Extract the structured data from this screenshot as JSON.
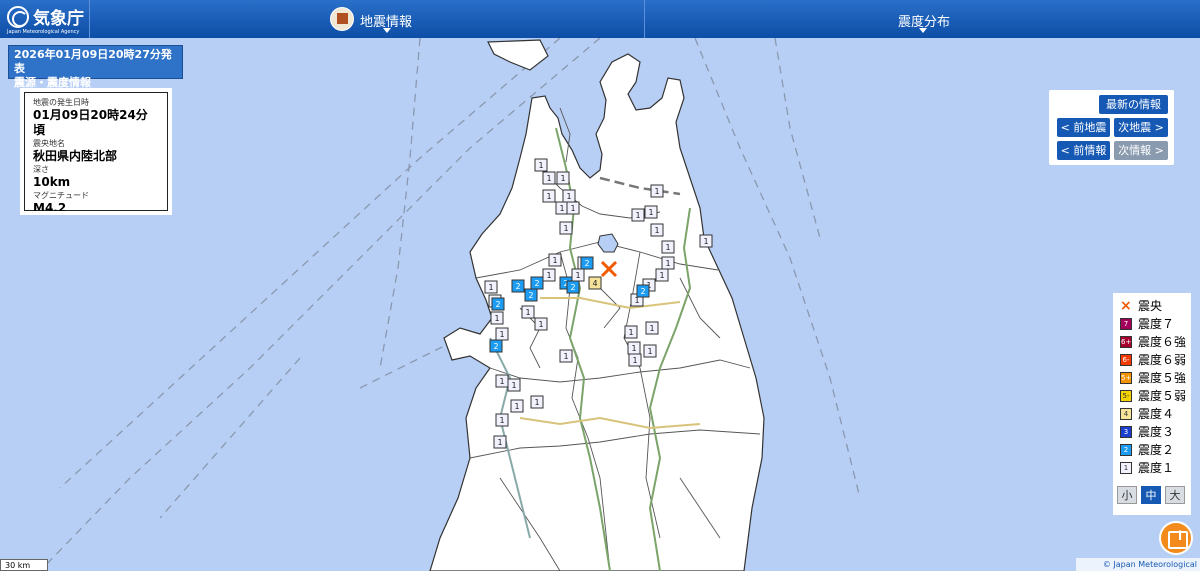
{
  "header": {
    "logo_text": "気象庁",
    "logo_sub": "Japan Meteorological Agency",
    "menu1_label": "地震情報",
    "menu2_label": "震度分布"
  },
  "report": {
    "line1": "2026年01月09日20時27分発表",
    "line2": "震源・震度情報"
  },
  "info": {
    "time_label": "地震の発生日時",
    "time_value": "01月09日20時24分頃",
    "place_label": "震央地名",
    "place_value": "秋田県内陸北部",
    "depth_label": "深さ",
    "depth_value": "10km",
    "mag_label": "マグニチュード",
    "mag_value": "M4.2"
  },
  "nav": {
    "latest": "最新の情報",
    "prev_eq": "< 前地震",
    "next_eq": "次地震 >",
    "prev_info": "< 前情報",
    "next_info": "次情報 >"
  },
  "legend": {
    "items": [
      {
        "label": "震央",
        "mark": "×",
        "color": "#f25a00"
      },
      {
        "label": "震度７",
        "mark": "7",
        "color": "#a3005c"
      },
      {
        "label": "震度６強",
        "mark": "6+",
        "color": "#a5002d"
      },
      {
        "label": "震度６弱",
        "mark": "6-",
        "color": "#f23a00"
      },
      {
        "label": "震度５強",
        "mark": "5+",
        "color": "#f29200"
      },
      {
        "label": "震度５弱",
        "mark": "5-",
        "color": "#f2d200"
      },
      {
        "label": "震度４",
        "mark": "4",
        "color": "#f5e39a"
      },
      {
        "label": "震度３",
        "mark": "3",
        "color": "#1c3ecf"
      },
      {
        "label": "震度２",
        "mark": "2",
        "color": "#1c9cf2"
      },
      {
        "label": "震度１",
        "mark": "1",
        "color": "#f2f2ff"
      }
    ],
    "size_small": "小",
    "size_medium": "中",
    "size_large": "大"
  },
  "scale_label": "30 km",
  "copyright": "© Japan Meteorological Agency",
  "map_data": {
    "epicenter_intensity_note": "",
    "stations": [
      {
        "v": "1"
      },
      {
        "v": "1"
      },
      {
        "v": "1"
      },
      {
        "v": "1"
      },
      {
        "v": "1"
      },
      {
        "v": "1"
      },
      {
        "v": "1"
      },
      {
        "v": "1"
      },
      {
        "v": "1"
      },
      {
        "v": "1"
      },
      {
        "v": "1"
      },
      {
        "v": "1"
      },
      {
        "v": "1"
      },
      {
        "v": "1"
      },
      {
        "v": "1"
      },
      {
        "v": "1"
      },
      {
        "v": "1"
      },
      {
        "v": "1"
      },
      {
        "v": "1"
      },
      {
        "v": "1"
      },
      {
        "v": "1"
      },
      {
        "v": "1"
      },
      {
        "v": "1"
      },
      {
        "v": "1"
      },
      {
        "v": "1"
      },
      {
        "v": "1"
      },
      {
        "v": "1"
      },
      {
        "v": "1"
      },
      {
        "v": "1"
      },
      {
        "v": "1"
      },
      {
        "v": "1"
      },
      {
        "v": "1"
      },
      {
        "v": "1"
      },
      {
        "v": "1"
      },
      {
        "v": "1"
      },
      {
        "v": "1"
      },
      {
        "v": "1"
      },
      {
        "v": "1"
      },
      {
        "v": "1"
      },
      {
        "v": "1"
      },
      {
        "v": "2"
      },
      {
        "v": "2"
      },
      {
        "v": "2"
      },
      {
        "v": "2"
      },
      {
        "v": "2"
      },
      {
        "v": "2"
      },
      {
        "v": "2"
      },
      {
        "v": "2"
      },
      {
        "v": "2"
      },
      {
        "v": "2"
      },
      {
        "v": "4"
      }
    ]
  }
}
